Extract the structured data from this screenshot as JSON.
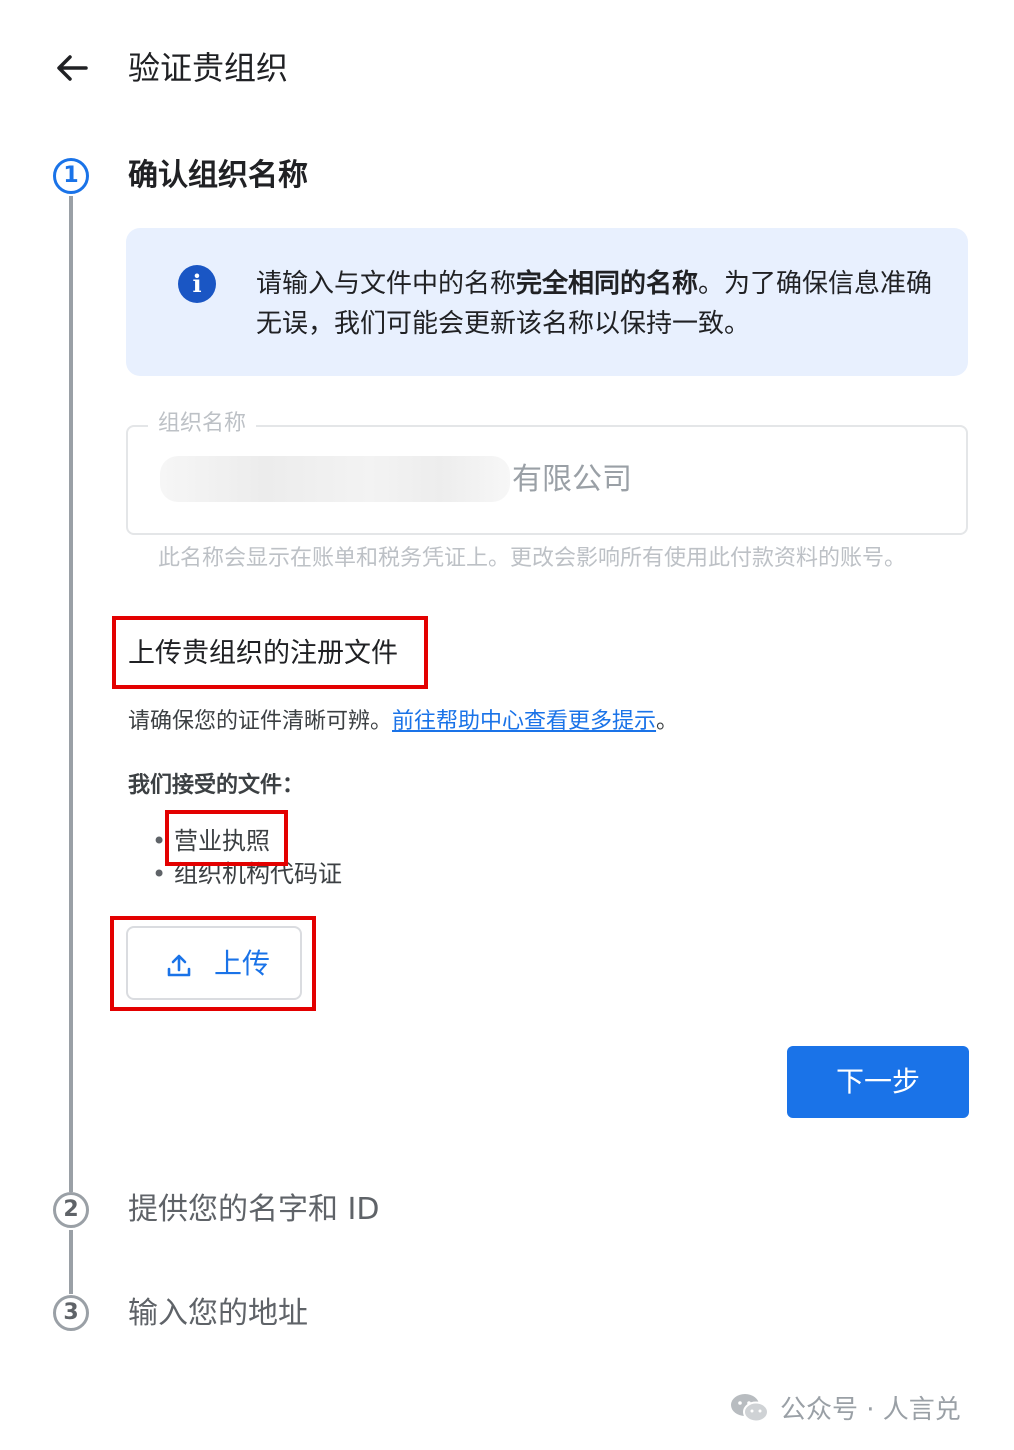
{
  "header": {
    "title": "验证贵组织",
    "back_icon": "arrow-left-icon"
  },
  "steps": [
    {
      "number": "1",
      "label": "确认组织名称",
      "state": "active"
    },
    {
      "number": "2",
      "label": "提供您的名字和 ID",
      "state": "inactive"
    },
    {
      "number": "3",
      "label": "输入您的地址",
      "state": "inactive"
    }
  ],
  "info_card": {
    "icon": "info-icon",
    "text_before": "请输入与文件中的名称",
    "text_bold": "完全相同的名称",
    "text_after": "。为了确保信息准确无误，我们可能会更新该名称以保持一致。"
  },
  "org_field": {
    "label": "组织名称",
    "value_visible": "有限公司",
    "helper": "此名称会显示在账单和税务凭证上。更改会影响所有使用此付款资料的账号。"
  },
  "upload": {
    "heading": "上传贵组织的注册文件",
    "hint": "请确保您的证件清晰可辨。",
    "help_link": "前往帮助中心查看更多提示",
    "hint_end": "。",
    "accepted_title": "我们接受的文件：",
    "accepted_docs": [
      "营业执照",
      "组织机构代码证"
    ],
    "button_label": "上传",
    "button_icon": "upload-icon"
  },
  "next_button": "下一步",
  "watermark": {
    "icon": "wechat-icon",
    "text": "公众号 · 人言兑"
  },
  "colors": {
    "primary": "#1a73e8",
    "info_bg": "#e8f0fe",
    "highlight_red": "#e30000",
    "stepper_gray": "#9aa0a6"
  }
}
